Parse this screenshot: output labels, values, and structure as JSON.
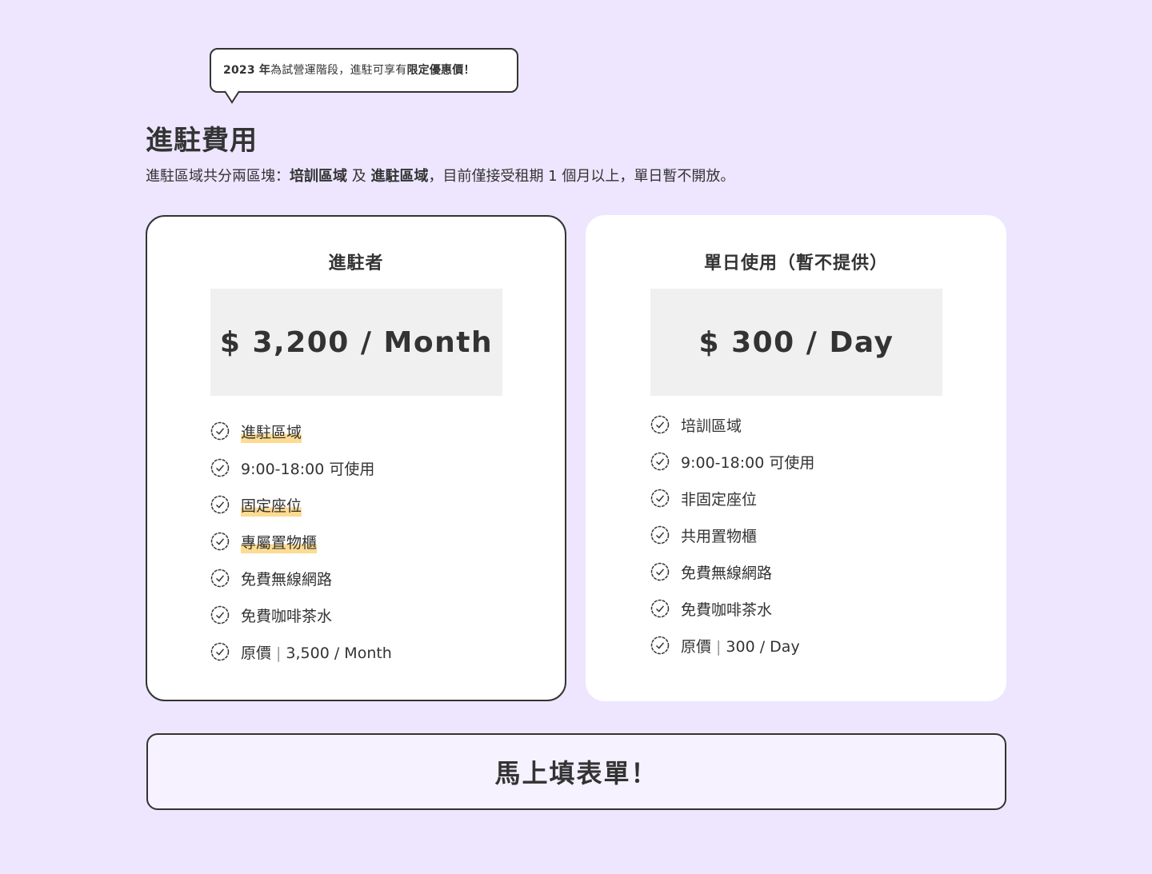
{
  "notice": {
    "bold_year": "2023 年",
    "text": "為試營運階段，進駐可享有",
    "bold_offer": "限定優惠價！"
  },
  "section": {
    "title": "進駐費用",
    "desc_prefix": "進駐區域共分兩區塊：",
    "area_a": "培訓區域",
    "conj": " 及 ",
    "area_b": "進駐區域",
    "desc_suffix": "，目前僅接受租期 1 個月以上，單日暫不開放。"
  },
  "plans": [
    {
      "title": "進駐者",
      "price": "$ 3,200 / Month",
      "features": [
        {
          "text": "進駐區域",
          "highlight": true
        },
        {
          "text": "9:00-18:00 可使用",
          "highlight": false
        },
        {
          "text": "固定座位",
          "highlight": true
        },
        {
          "text": "專屬置物櫃",
          "highlight": true
        },
        {
          "text": "免費無線網路",
          "highlight": false
        },
        {
          "text": "免費咖啡茶水",
          "highlight": false
        }
      ],
      "original_label": "原價",
      "original_price": "3,500 / Month"
    },
    {
      "title": "單日使用（暫不提供）",
      "price": "$ 300 / Day",
      "features": [
        {
          "text": "培訓區域",
          "highlight": false
        },
        {
          "text": "9:00-18:00 可使用",
          "highlight": false
        },
        {
          "text": "非固定座位",
          "highlight": false
        },
        {
          "text": "共用置物櫃",
          "highlight": false
        },
        {
          "text": "免費無線網路",
          "highlight": false
        },
        {
          "text": "免費咖啡茶水",
          "highlight": false
        }
      ],
      "original_label": "原價",
      "original_price": "300 / Day"
    }
  ],
  "cta": {
    "label": "馬上填表單！"
  },
  "colors": {
    "background": "#ede6fe",
    "highlight": "#fddb92",
    "border": "#333333"
  }
}
